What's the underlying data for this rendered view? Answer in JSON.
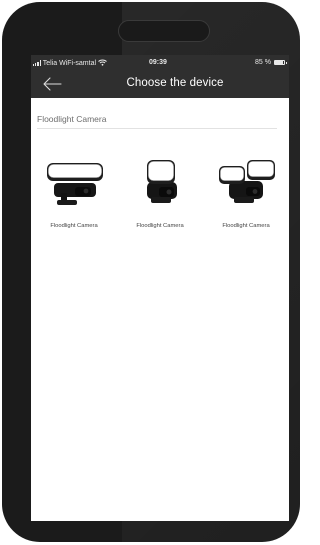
{
  "status": {
    "carrier": "Telia WiFi-samtal",
    "time": "09:39",
    "battery": "85 %"
  },
  "nav": {
    "title": "Choose the device",
    "back_icon": "arrow-left-icon"
  },
  "section": {
    "title": "Floodlight Camera"
  },
  "devices": [
    {
      "label": "Floodlight Camera",
      "variant": "wide-bar-light"
    },
    {
      "label": "Floodlight Camera",
      "variant": "single-panel-light"
    },
    {
      "label": "Floodlight Camera",
      "variant": "dual-panel-light"
    }
  ],
  "colors": {
    "header_bg": "#2f2f2f",
    "frame": "#1b1b1b",
    "screen_bg": "#ffffff"
  }
}
